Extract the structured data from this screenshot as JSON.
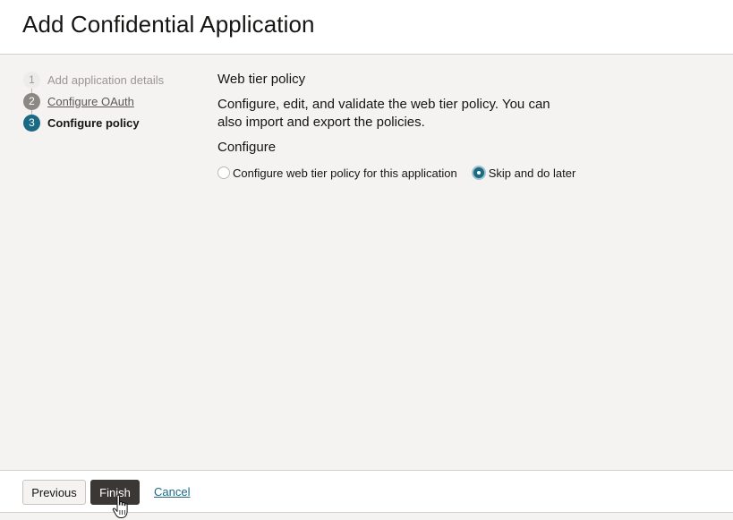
{
  "header": {
    "title": "Add Confidential Application"
  },
  "stepper": {
    "steps": [
      {
        "number": "1",
        "label": "Add application details",
        "state": "completed"
      },
      {
        "number": "2",
        "label": "Configure OAuth",
        "state": "visited"
      },
      {
        "number": "3",
        "label": "Configure policy",
        "state": "current"
      }
    ]
  },
  "content": {
    "section_title": "Web tier policy",
    "description": "Configure, edit, and validate the web tier policy. You can also import and export the policies.",
    "configure_label": "Configure",
    "options": [
      {
        "label": "Configure web tier policy for this application",
        "selected": false
      },
      {
        "label": "Skip and do later",
        "selected": true
      }
    ]
  },
  "footer": {
    "previous_label": "Previous",
    "finish_label": "Finish",
    "cancel_label": "Cancel"
  },
  "colors": {
    "accent": "#1b6a84",
    "primary_button": "#3b3734",
    "page_background": "#f5f3f1"
  },
  "icons": {
    "cursor": "hand-pointer-icon"
  }
}
